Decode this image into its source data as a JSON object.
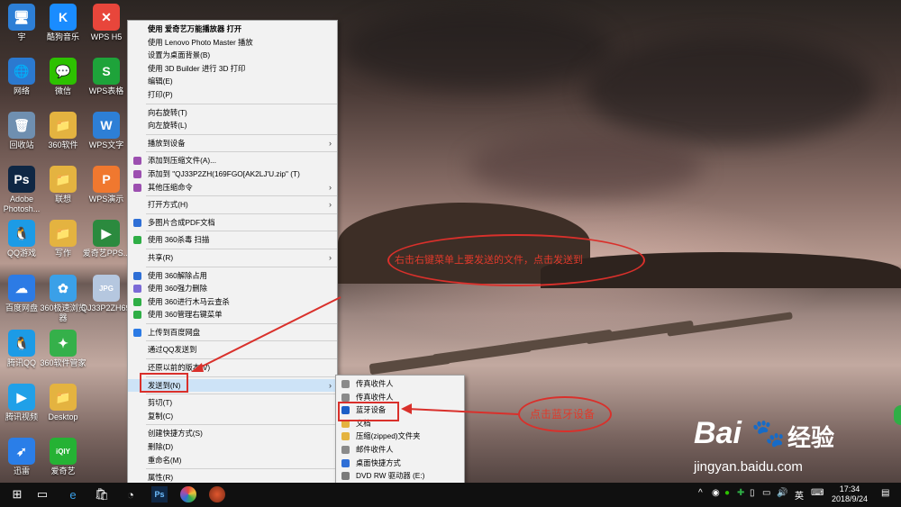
{
  "desktop_icons": [
    {
      "label": "宇",
      "color": "#2d7fd6",
      "glyph": "🖥"
    },
    {
      "label": "酷狗音乐",
      "color": "#1a8cff",
      "glyph": "K"
    },
    {
      "label": "WPS H5",
      "color": "#e8463b",
      "glyph": "✕"
    },
    {
      "label": "网络",
      "color": "#2b79d0",
      "glyph": "🌐"
    },
    {
      "label": "微信",
      "color": "#2dc100",
      "glyph": "💬"
    },
    {
      "label": "WPS表格",
      "color": "#1ea33a",
      "glyph": "S"
    },
    {
      "label": "回收站",
      "color": "#6f8fb0",
      "glyph": "🗑"
    },
    {
      "label": "360软件",
      "color": "#e4b340",
      "glyph": "📁"
    },
    {
      "label": "WPS文字",
      "color": "#2d7fd6",
      "glyph": "W"
    },
    {
      "label": "Adobe Photosh...",
      "color": "#0f2744",
      "glyph": "Ps"
    },
    {
      "label": "联想",
      "color": "#e4b340",
      "glyph": "📁"
    },
    {
      "label": "WPS演示",
      "color": "#f0782f",
      "glyph": "P"
    },
    {
      "label": "QQ游戏",
      "color": "#1c9be6",
      "glyph": "🐧"
    },
    {
      "label": "写作",
      "color": "#e4b340",
      "glyph": "📁"
    },
    {
      "label": "爱奇艺PPS...",
      "color": "#2b8a3e",
      "glyph": "▶"
    },
    {
      "label": "百度网盘",
      "color": "#2c7be5",
      "glyph": "☁"
    },
    {
      "label": "360极速浏览器",
      "color": "#3aa0e8",
      "glyph": "✿"
    },
    {
      "label": "QJ33P2ZH69FGO[AK2LJ'U...",
      "color": "#b5c7df",
      "glyph": "JPG"
    },
    {
      "label": "腾讯QQ",
      "color": "#1c9be6",
      "glyph": "🐧"
    },
    {
      "label": "360软件管家",
      "color": "#35b04a",
      "glyph": "✦"
    },
    {
      "label": "腾讯视频",
      "color": "#20a0e8",
      "glyph": "▶"
    },
    {
      "label": "Desktop",
      "color": "#e4b340",
      "glyph": "📁"
    },
    {
      "label": "迅雷",
      "color": "#2a7ee8",
      "glyph": "➶"
    },
    {
      "label": "爱奇艺",
      "color": "#25b234",
      "glyph": "iQIY"
    }
  ],
  "context_menu": {
    "groups": [
      [
        {
          "label": "使用 爱奇艺万能播放器 打开",
          "bold": true
        },
        {
          "label": "使用 Lenovo Photo Master 播放"
        },
        {
          "label": "设置为桌面背景(B)"
        },
        {
          "label": "使用 3D Builder 进行 3D 打印"
        },
        {
          "label": "编辑(E)"
        },
        {
          "label": "打印(P)"
        }
      ],
      [
        {
          "label": "向右旋转(T)"
        },
        {
          "label": "向左旋转(L)"
        }
      ],
      [
        {
          "label": "播放到设备",
          "submenu": true
        }
      ],
      [
        {
          "label": "添加到压缩文件(A)...",
          "icon_color": "#9c4fb0"
        },
        {
          "label": "添加到 \"QJ33P2ZH(169FGO[AK2LJ'U.zip\" (T)",
          "icon_color": "#9c4fb0"
        },
        {
          "label": "其他压缩命令",
          "icon_color": "#9c4fb0",
          "submenu": true
        }
      ],
      [
        {
          "label": "打开方式(H)",
          "submenu": true
        }
      ],
      [
        {
          "label": "多图片合成PDF文档",
          "icon_color": "#2f6fd6"
        }
      ],
      [
        {
          "label": "使用 360杀毒 扫描",
          "icon_color": "#2fae46"
        }
      ],
      [
        {
          "label": "共享(R)",
          "submenu": true
        }
      ],
      [
        {
          "label": "使用 360解除占用",
          "icon_color": "#2f6fd6"
        },
        {
          "label": "使用 360强力删除",
          "icon_color": "#7b6ad6"
        },
        {
          "label": "使用 360进行木马云查杀",
          "icon_color": "#2fae46"
        },
        {
          "label": "使用 360管理右键菜单",
          "icon_color": "#2fae46"
        }
      ],
      [
        {
          "label": "上传到百度网盘",
          "icon_color": "#2c7be5"
        }
      ],
      [
        {
          "label": "通过QQ发送到"
        }
      ],
      [
        {
          "label": "还原以前的版本(V)"
        }
      ],
      [
        {
          "label": "发送到(N)",
          "submenu": true,
          "highlighted": true
        }
      ],
      [
        {
          "label": "剪切(T)"
        },
        {
          "label": "复制(C)"
        }
      ],
      [
        {
          "label": "创建快捷方式(S)"
        },
        {
          "label": "删除(D)"
        },
        {
          "label": "重命名(M)"
        }
      ],
      [
        {
          "label": "属性(R)"
        }
      ]
    ]
  },
  "send_to_menu": [
    {
      "label": "传真收件人",
      "icon_color": "#8a8a8a"
    },
    {
      "label": "传真收件人",
      "icon_color": "#8a8a8a"
    },
    {
      "label": "蓝牙设备",
      "icon_color": "#1b5fc7",
      "boxed": true
    },
    {
      "label": "文档",
      "icon_color": "#e4b340"
    },
    {
      "label": "压缩(zipped)文件夹",
      "icon_color": "#e4b340"
    },
    {
      "label": "邮件收件人",
      "icon_color": "#8a8a8a"
    },
    {
      "label": "桌面快捷方式",
      "icon_color": "#2f6fd6"
    },
    {
      "label": "DVD RW 驱动器 (E:)",
      "icon_color": "#7a7a7a"
    }
  ],
  "annotations": {
    "top": "右击右键菜单上要发送的文件，点击发送到",
    "bottom": "点击蓝牙设备"
  },
  "colors": {
    "annotation_red": "#d9302b",
    "taskbar": "#101010",
    "menu_bg": "#f2f2f2",
    "highlight": "#cde3f7"
  },
  "taskbar": {
    "tray_lang": "英",
    "time": "17:34",
    "date": "2018/9/24",
    "tray_chevron": "^"
  },
  "watermark": {
    "brand": "Bai",
    "brand_suffix": "经验",
    "url": "jingyan.baidu.com"
  }
}
